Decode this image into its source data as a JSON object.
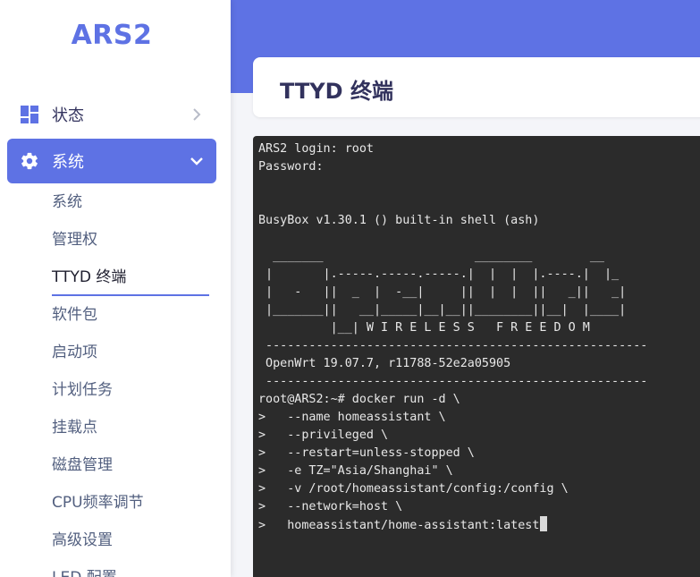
{
  "sidebar": {
    "brand": "ARS2",
    "nav": [
      {
        "label": "状态",
        "icon": "dashboard-icon",
        "expanded": false
      },
      {
        "label": "系统",
        "icon": "gear-icon",
        "expanded": true
      }
    ],
    "submenu": [
      {
        "label": "系统"
      },
      {
        "label": "管理权"
      },
      {
        "label": "TTYD 终端",
        "active": true
      },
      {
        "label": "软件包"
      },
      {
        "label": "启动项"
      },
      {
        "label": "计划任务"
      },
      {
        "label": "挂载点"
      },
      {
        "label": "磁盘管理"
      },
      {
        "label": "CPU频率调节"
      },
      {
        "label": "高级设置"
      },
      {
        "label": "LED 配置"
      }
    ]
  },
  "page": {
    "title": "TTYD 终端"
  },
  "terminal": {
    "lines": [
      "ARS2 login: root",
      "Password:",
      "",
      "",
      "BusyBox v1.30.1 () built-in shell (ash)",
      "",
      "  _______                     ________        __",
      " |       |.-----.-----.-----.|  |  |  |.----.|  |_",
      " |   -   ||  _  |  -__|     ||  |  |  ||   _||   _|",
      " |_______||   __|_____|__|__||________||__|  |____|",
      "          |__| W I R E L E S S   F R E E D O M",
      " -----------------------------------------------------",
      " OpenWrt 19.07.7, r11788-52e2a05905",
      " -----------------------------------------------------",
      "root@ARS2:~# docker run -d \\",
      ">   --name homeassistant \\",
      ">   --privileged \\",
      ">   --restart=unless-stopped \\",
      ">   -e TZ=\"Asia/Shanghai\" \\",
      ">   -v /root/homeassistant/config:/config \\",
      ">   --network=host \\",
      ">   homeassistant/home-assistant:latest"
    ]
  },
  "colors": {
    "accent": "#5e72e4",
    "terminal_bg": "#2b2b2b",
    "terminal_fg": "#e8e8e8"
  }
}
